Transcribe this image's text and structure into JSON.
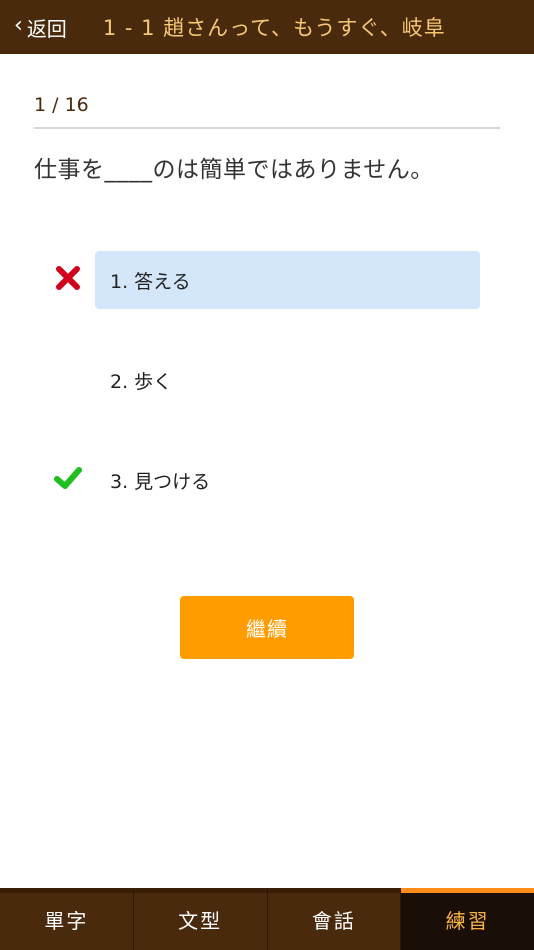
{
  "header": {
    "back_label": "返回",
    "title": "1 - 1 趙さんって、もうすぐ、岐阜"
  },
  "quiz": {
    "progress": "1 / 16",
    "question": "仕事を____のは簡単ではありません。",
    "options": [
      {
        "label": "1. 答える",
        "state": "selected-wrong"
      },
      {
        "label": "2. 歩く",
        "state": "none"
      },
      {
        "label": "3. 見つける",
        "state": "correct"
      }
    ],
    "continue_label": "繼續"
  },
  "tabs": [
    {
      "label": "單字",
      "active": false
    },
    {
      "label": "文型",
      "active": false
    },
    {
      "label": "會話",
      "active": false
    },
    {
      "label": "練習",
      "active": true
    }
  ],
  "colors": {
    "header_bg": "#4a2a0c",
    "title_text": "#f7c873",
    "selected_option_bg": "#d4e6fa",
    "continue_button": "#ff9c00",
    "wrong_mark": "#d0021b",
    "correct_mark": "#1fbf1f",
    "active_tab_text": "#f7b24a",
    "active_tab_indicator": "#ff8c1a"
  }
}
